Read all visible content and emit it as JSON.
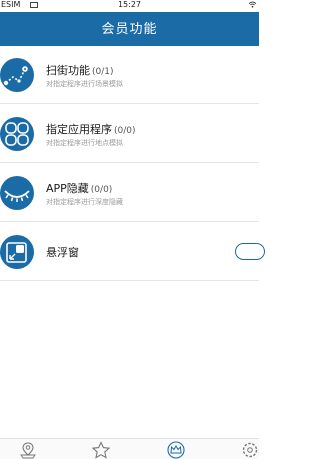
{
  "status_bar": {
    "carrier": "ESIM",
    "time": "15:27"
  },
  "header": {
    "title": "会员功能"
  },
  "items": [
    {
      "title": "扫街功能",
      "count": "(0/1)",
      "desc": "对指定程序进行场景模拟"
    },
    {
      "title": "指定应用程序",
      "count": "(0/0)",
      "desc": "对指定程序进行地点模拟"
    },
    {
      "title": "APP隐藏",
      "count": "(0/0)",
      "desc": "对指定程序进行深度隐藏"
    },
    {
      "title": "悬浮窗",
      "count": "",
      "desc": ""
    }
  ],
  "toggle": {
    "on": false
  },
  "tabs": [
    {
      "icon": "location-pin-icon"
    },
    {
      "icon": "star-icon"
    },
    {
      "icon": "crown-icon",
      "active": true
    },
    {
      "icon": "settings-gear-icon"
    }
  ],
  "colors": {
    "accent": "#1b6ba6",
    "divider": "#e4e4e4",
    "desc": "#9a9a9a"
  }
}
